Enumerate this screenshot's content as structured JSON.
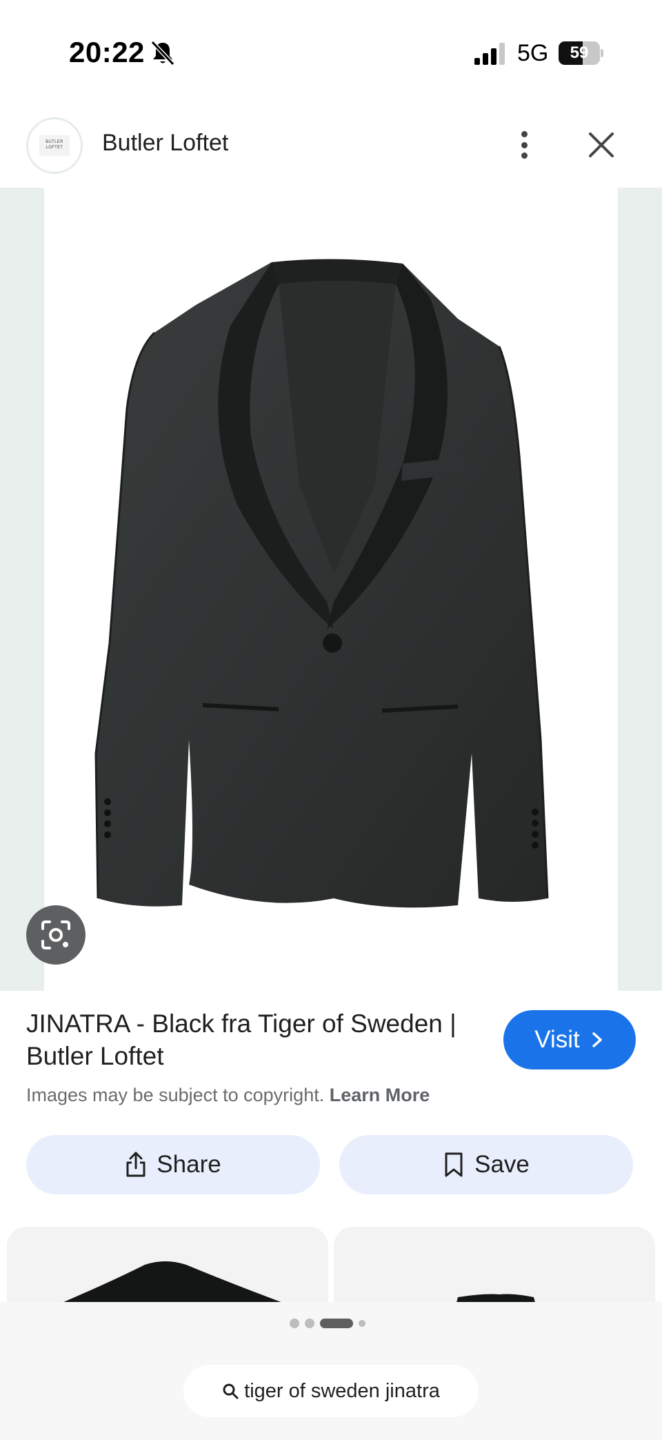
{
  "status_bar": {
    "time": "20:22",
    "network": "5G",
    "battery": "59",
    "battery_level": 0.59
  },
  "header": {
    "site_name": "Butler Loftet",
    "logo_text": "BUTLER LOFTET"
  },
  "result": {
    "title": "JINATRA - Black fra Tiger of Sweden | Butler Loftet",
    "visit_label": "Visit",
    "copyright_text": "Images may be subject to copyright.",
    "learn_more": "Learn More"
  },
  "actions": {
    "share_label": "Share",
    "save_label": "Save"
  },
  "carousel": {
    "pages": 4,
    "active_index": 2
  },
  "search": {
    "query": "tiger of sweden jinatra"
  },
  "colors": {
    "accent": "#1a73e8",
    "action_bg": "#e8eefb",
    "image_side_bg": "#e8efed"
  }
}
